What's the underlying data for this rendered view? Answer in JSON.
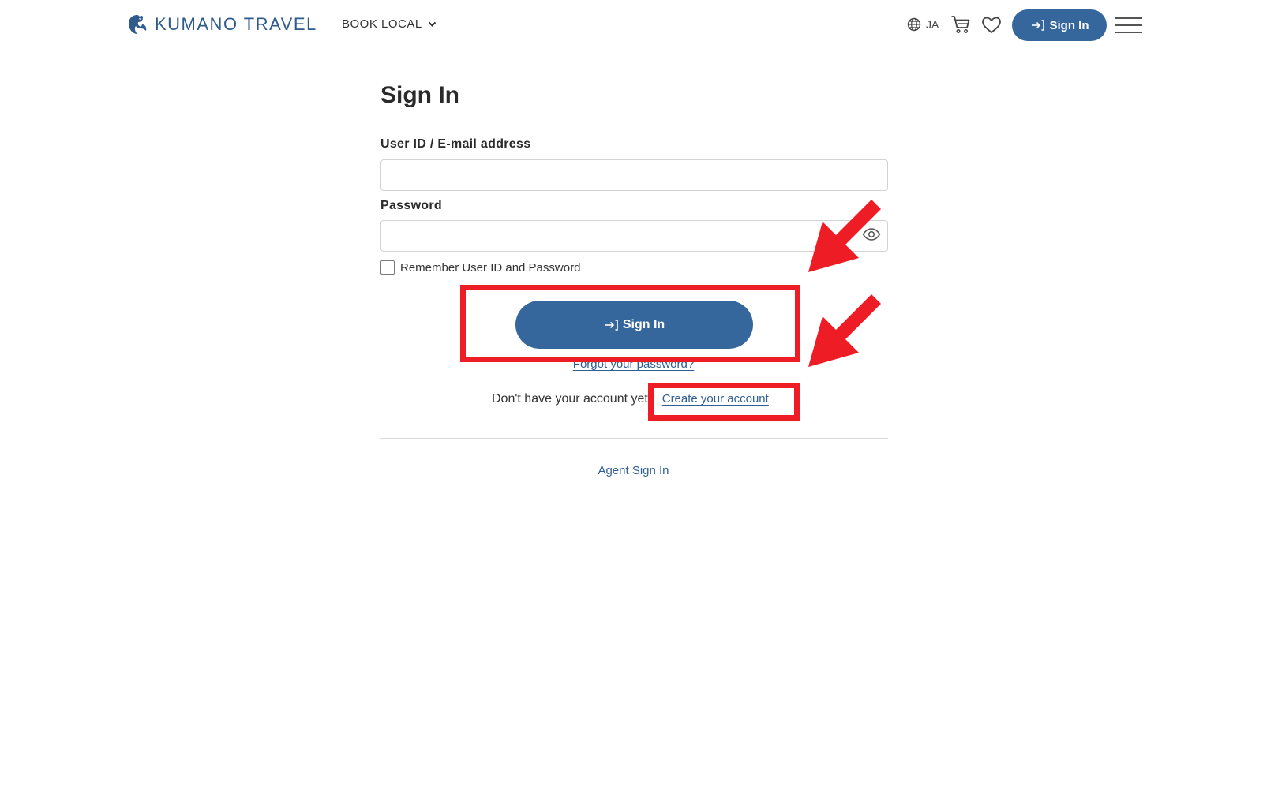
{
  "header": {
    "brand": "KUMANO TRAVEL",
    "nav_book_local": "BOOK LOCAL",
    "language": "JA",
    "signin_label": "Sign In",
    "icons": [
      "crane-logo-icon",
      "chevron-down-icon",
      "globe-icon",
      "cart-icon",
      "heart-icon",
      "sign-in-arrow-icon",
      "hamburger-menu-icon"
    ]
  },
  "form": {
    "title": "Sign In",
    "user_label": "User ID / E-mail address",
    "user_value": "",
    "password_label": "Password",
    "password_value": "",
    "remember_label": "Remember User ID and Password",
    "remember_checked": false,
    "submit_label": "Sign In",
    "forgot_link": "Forgot your password?",
    "no_account_text": "Don't have your account yet?",
    "create_account_link": "Create your account",
    "agent_link": "Agent Sign In"
  },
  "annotations": {
    "color": "#ee1c24",
    "highlighted": [
      "Sign In button",
      "Create your account link"
    ]
  },
  "colors": {
    "brand_blue": "#35669c",
    "link_blue": "#2f5f93"
  }
}
